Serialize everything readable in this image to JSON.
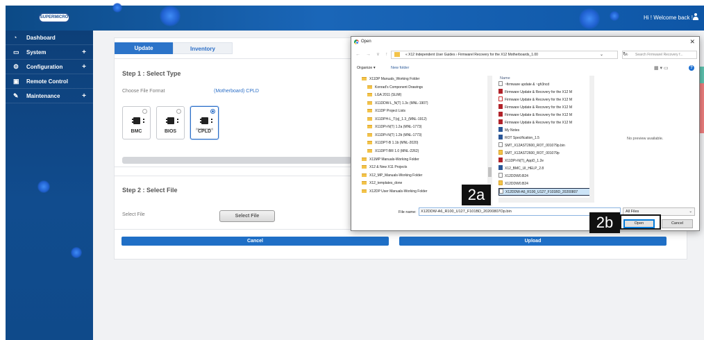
{
  "brand": {
    "logo_text": "SUPERMICRO"
  },
  "header": {
    "welcome": "Hi ! Welcome back !"
  },
  "sidebar": {
    "items": [
      {
        "label": "Dashboard",
        "icon": "dashboard-icon",
        "expand": ""
      },
      {
        "label": "System",
        "icon": "laptop-icon",
        "expand": "+"
      },
      {
        "label": "Configuration",
        "icon": "gear-icon",
        "expand": "+"
      },
      {
        "label": "Remote Control",
        "icon": "console-icon",
        "expand": ""
      },
      {
        "label": "Maintenance",
        "icon": "wrench-icon",
        "expand": "+"
      }
    ]
  },
  "tabs": {
    "update": "Update",
    "inventory": "Inventory"
  },
  "step1": {
    "title": "Step 1 : Select Type",
    "choose_label": "Choose File Format",
    "selected_format": "(Motherboard) CPLD",
    "formats": [
      {
        "name": "BMC",
        "sub": ""
      },
      {
        "name": "BIOS",
        "sub": ""
      },
      {
        "name": "CPLD",
        "sub": "(Motherboard)"
      }
    ]
  },
  "step2": {
    "title": "Step 2 : Select File",
    "select_label": "Select File",
    "select_button": "Select File"
  },
  "actions": {
    "cancel": "Cancel",
    "upload": "Upload"
  },
  "dialog": {
    "title": "Open",
    "close": "✕",
    "nav": "← → ∨ ↑",
    "path": "« X12 Independent User Guides  ›  Firmwarel Recovery for the X12 Motherboards_1.00",
    "search_placeholder": "Search Firmwarel Recovery f...",
    "organize": "Organize ▾",
    "new_folder": "New folder",
    "tree": [
      "X11DP Manuals_Working Folder",
      "Konrad's Component Drawings",
      "LGA 2011 (SLIM)",
      "X11DDW-L_N(T) 1.3c (MNL-1907)",
      "X11DP Project Lists",
      "X11DPH-L_T(q)_1.3_(MNL-1912)",
      "X11DPi-N(T) 1.2a (MNL-1773)",
      "X11DPi-N(T) 1.2b (MNL-1773)",
      "X11DPT-B 1.1b (MNL-2020)",
      "X11DPT-BR 1.0 (MNL-2262)",
      "X11MP Manuals-Working Folder",
      "X12 & New X11  Projects",
      "X12_MP_Manuals-Working Folder",
      "X12_templates_done",
      "X12DP User Manuals-Working Folder"
    ],
    "files_header": "Name",
    "files": [
      {
        "name": "~firmware update & ~gh3ncd",
        "type": "doc"
      },
      {
        "name": "Firmware Update & Recovery for the X12 M",
        "type": "pdf"
      },
      {
        "name": "Firmware Update & Recovery for the X12 M",
        "type": "pdf2"
      },
      {
        "name": "Firmware Update & Recovery for the X12 M",
        "type": "pdf"
      },
      {
        "name": "Firmware Update & Recovery for the X12 M",
        "type": "pdf"
      },
      {
        "name": "Firmware Update & Recovery for the X12 M",
        "type": "pdf"
      },
      {
        "name": "My Notes",
        "type": "word"
      },
      {
        "name": "ROT Specification_1.5",
        "type": "word"
      },
      {
        "name": "SMT_X12AST2600_ROT_001079p.bin",
        "type": "doc"
      },
      {
        "name": "SMT_X12AST2600_ROT_001079p",
        "type": "fold"
      },
      {
        "name": "X11DPi-N(T)_AppD_1.2e",
        "type": "pdf"
      },
      {
        "name": "X12_BMC_UI_HELP_2.8",
        "type": "word"
      },
      {
        "name": "X12DDW0.B24",
        "type": "doc"
      },
      {
        "name": "X12DDW0.B24",
        "type": "fold"
      },
      {
        "name": "X12DDW-A6_R100_U127_F101BD_20200807",
        "type": "doc"
      }
    ],
    "no_preview": "No preview available.",
    "file_name_label": "File name:",
    "file_name_value": "X12DDW-A6_R100_U127_F101BD_20200807Op.bin",
    "filter": "All Files",
    "open": "Open",
    "cancel": "Cancel"
  },
  "callouts": {
    "a": "2a",
    "b": "2b"
  }
}
